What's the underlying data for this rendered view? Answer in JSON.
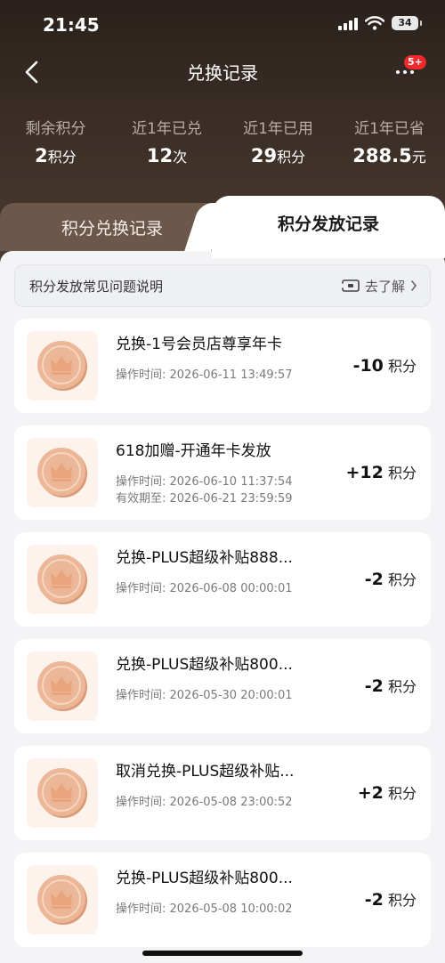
{
  "status_bar": {
    "time": "21:45",
    "battery": "34"
  },
  "nav": {
    "title": "兑换记录",
    "badge": "5+"
  },
  "stats": [
    {
      "label": "剩余积分",
      "value": "2",
      "unit": "积分"
    },
    {
      "label": "近1年已兑",
      "value": "12",
      "unit": "次"
    },
    {
      "label": "近1年已用",
      "value": "29",
      "unit": "积分"
    },
    {
      "label": "近1年已省",
      "value": "288.5",
      "unit": "元"
    }
  ],
  "tabs": {
    "left": "积分兑换记录",
    "right": "积分发放记录",
    "active": "right"
  },
  "faq": {
    "text": "积分发放常见问题说明",
    "link": "去了解"
  },
  "records": [
    {
      "title": "兑换-1号会员店尊享年卡",
      "time": "操作时间: 2026-06-11 13:49:57",
      "expiry": "",
      "amount": "-10",
      "unit": "积分"
    },
    {
      "title": "618加赠-开通年卡发放",
      "time": "操作时间: 2026-06-10 11:37:54",
      "expiry": "有效期至: 2026-06-21 23:59:59",
      "amount": "+12",
      "unit": "积分"
    },
    {
      "title": "兑换-PLUS超级补贴888...",
      "time": "操作时间: 2026-06-08 00:00:01",
      "expiry": "",
      "amount": "-2",
      "unit": "积分"
    },
    {
      "title": "兑换-PLUS超级补贴800...",
      "time": "操作时间: 2026-05-30 20:00:01",
      "expiry": "",
      "amount": "-2",
      "unit": "积分"
    },
    {
      "title": "取消兑换-PLUS超级补贴...",
      "time": "操作时间: 2026-05-08 23:00:52",
      "expiry": "",
      "amount": "+2",
      "unit": "积分"
    },
    {
      "title": "兑换-PLUS超级补贴800...",
      "time": "操作时间: 2026-05-08 10:00:02",
      "expiry": "",
      "amount": "-2",
      "unit": "积分"
    }
  ],
  "icons": {
    "back": "chevron-left-icon",
    "more": "more-dots-icon",
    "coin": "crown-coin-icon",
    "faq": "ticket-icon",
    "faq_arrow": "chevron-right-icon"
  },
  "colors": {
    "header_bg": "#2a211c",
    "tab_inactive": "#6b584b",
    "badge": "#f0292b",
    "coin_bg": "#fdf3ec",
    "coin": "#e6a985"
  }
}
